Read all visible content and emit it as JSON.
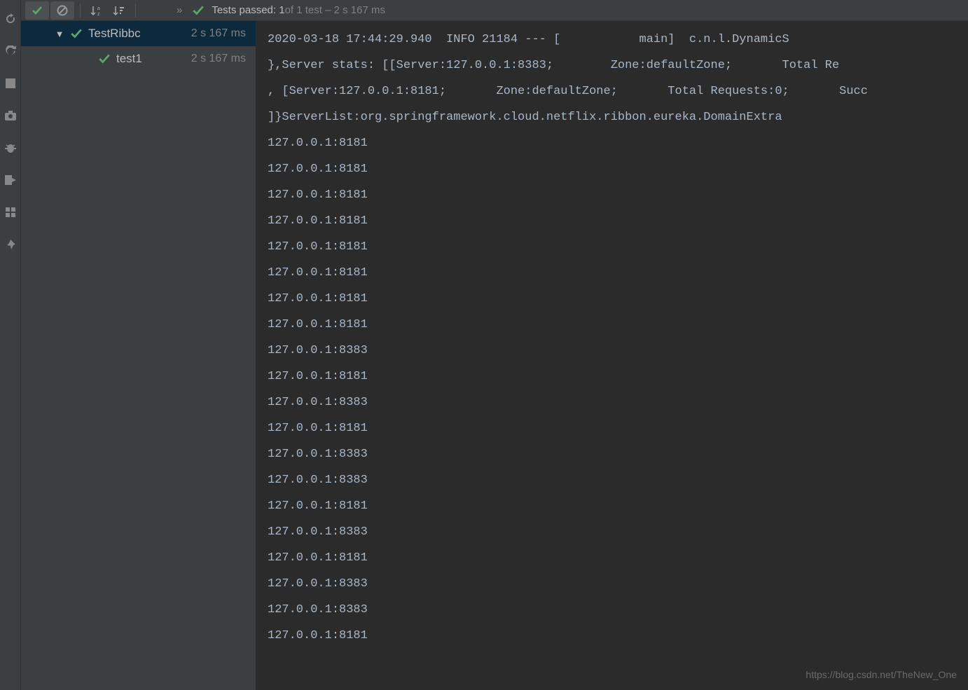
{
  "topbar": {
    "status_prefix": "Tests passed: 1",
    "status_suffix": " of 1 test – 2 s 167 ms"
  },
  "tree": {
    "items": [
      {
        "name": "TestRibbc",
        "time": "2 s 167 ms",
        "selected": true,
        "child": false,
        "hasArrow": true
      },
      {
        "name": "test1",
        "time": "2 s 167 ms",
        "selected": false,
        "child": true,
        "hasArrow": false
      }
    ]
  },
  "console": {
    "lines": [
      "2020-03-18 17:44:29.940  INFO 21184 --- [           main]  c.n.l.DynamicS",
      "},Server stats: [[Server:127.0.0.1:8383;\tZone:defaultZone;\tTotal Re",
      ", [Server:127.0.0.1:8181;\tZone:defaultZone;\tTotal Requests:0;\tSucc",
      "]}ServerList:org.springframework.cloud.netflix.ribbon.eureka.DomainExtra",
      "127.0.0.1:8181",
      "127.0.0.1:8181",
      "127.0.0.1:8181",
      "127.0.0.1:8181",
      "127.0.0.1:8181",
      "127.0.0.1:8181",
      "127.0.0.1:8181",
      "127.0.0.1:8181",
      "127.0.0.1:8383",
      "127.0.0.1:8181",
      "127.0.0.1:8383",
      "127.0.0.1:8181",
      "127.0.0.1:8383",
      "127.0.0.1:8383",
      "127.0.0.1:8181",
      "127.0.0.1:8383",
      "127.0.0.1:8181",
      "127.0.0.1:8383",
      "127.0.0.1:8383",
      "127.0.0.1:8181"
    ]
  },
  "watermark": "https://blog.csdn.net/TheNew_One"
}
